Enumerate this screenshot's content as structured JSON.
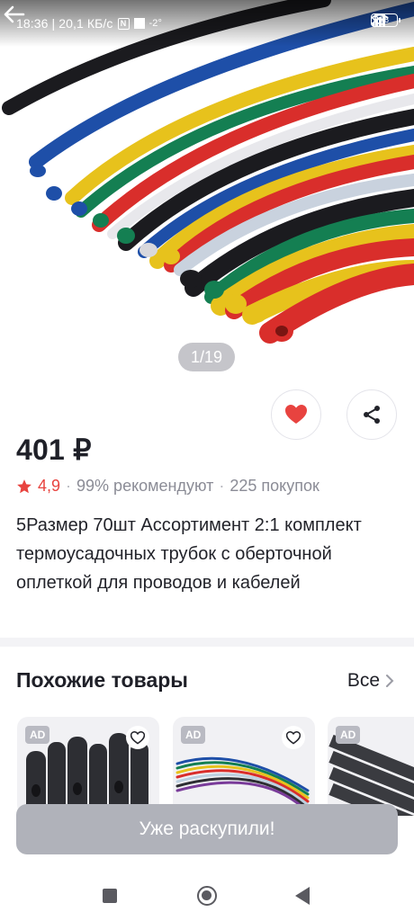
{
  "status_bar": {
    "time_speed": "18:36 | 20,1 КБ/с",
    "nfc_label": "N",
    "temperature": "-2°",
    "battery": "78"
  },
  "gallery": {
    "counter": "1/19"
  },
  "product": {
    "price": "401 ₽",
    "rating": "4,9",
    "recommend": "99% рекомендуют",
    "purchases": "225 покупок",
    "title": "5Размер 70шт Ассортимент 2:1 комплект термоусадочных трубок с оберточной оплеткой для проводов и кабелей"
  },
  "similar": {
    "heading": "Похожие товары",
    "see_all": "Все",
    "cards": [
      {
        "ad_label": "AD"
      },
      {
        "ad_label": "AD"
      },
      {
        "ad_label": "AD"
      }
    ]
  },
  "footer": {
    "sold_out_label": "Уже раскупили!"
  },
  "colors": {
    "heart": "#e8433f",
    "star": "#e8433f",
    "sold_out_button": "#b0b2ba"
  },
  "icons": [
    "back-arrow-icon",
    "bluetooth-icon",
    "signal-icon",
    "wifi-icon",
    "battery-icon",
    "heart-icon",
    "share-icon",
    "star-icon",
    "chevron-right-icon",
    "heart-outline-icon",
    "recents-icon",
    "home-icon",
    "back-triangle-icon"
  ]
}
